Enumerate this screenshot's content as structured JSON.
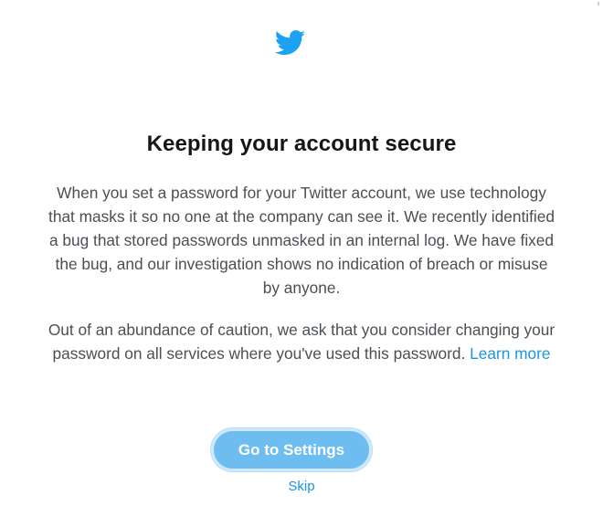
{
  "logo": {
    "icon": "twitter-bird-icon",
    "color": "#1da1f2"
  },
  "heading": "Keeping your account secure",
  "paragraph1": {
    "lines": [
      "When you set a password for your Twitter account, we use technology",
      "that masks it so no one at the company can see it. We recently identified",
      "a bug that stored passwords unmasked in an internal log. We have fixed",
      "the bug, and our investigation shows no indication of breach or misuse",
      "by anyone."
    ]
  },
  "paragraph2": {
    "lines": [
      "Out of an abundance of caution, we ask that you consider changing your",
      "password on all services where you've used this password."
    ],
    "link_label": "Learn more"
  },
  "actions": {
    "settings_label": "Go to Settings",
    "skip_label": "Skip"
  },
  "colors": {
    "link": "#1b95e0",
    "button": "#6ebdf0",
    "heading": "#14171a",
    "body_text": "#4a4f54"
  }
}
